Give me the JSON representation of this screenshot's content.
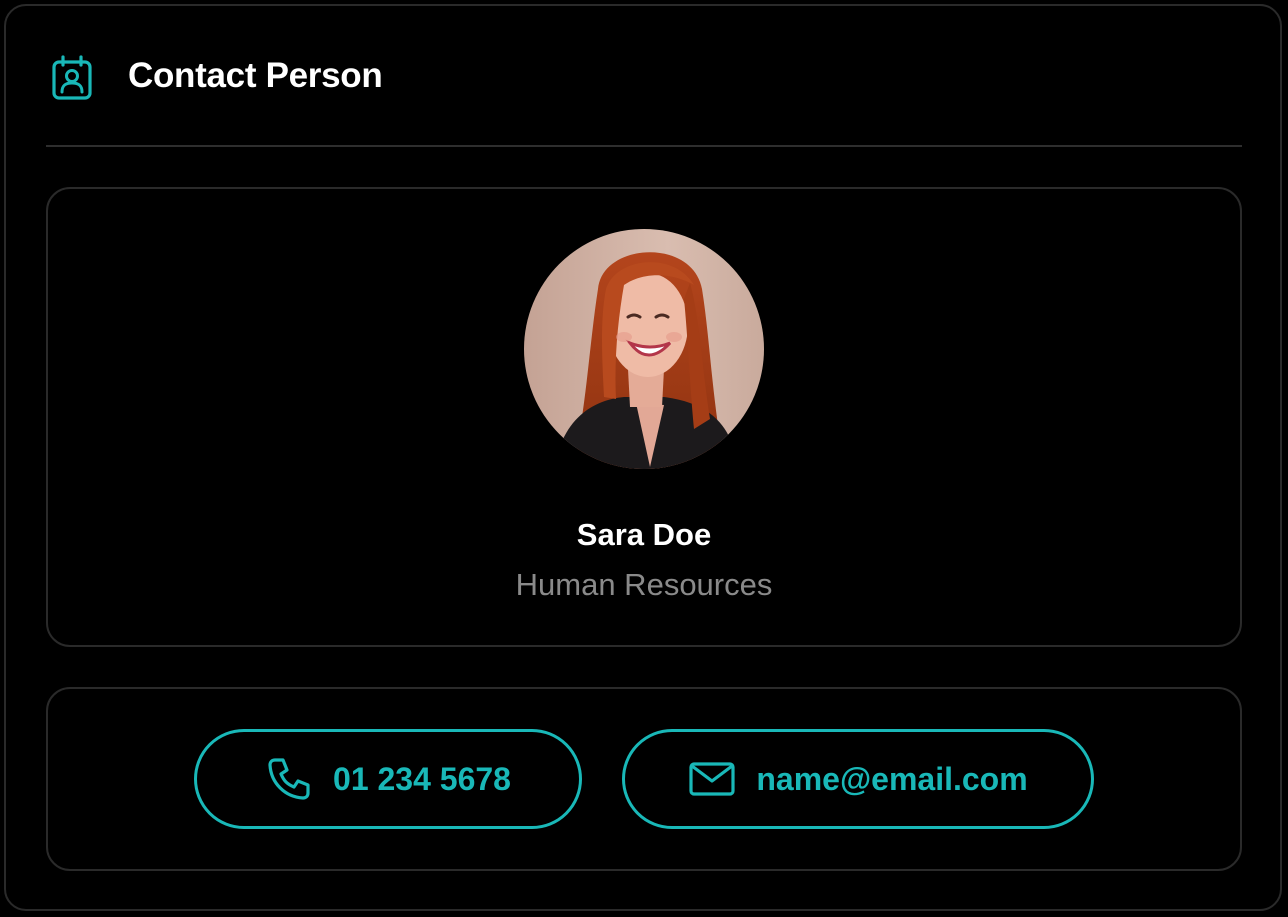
{
  "header": {
    "title": "Contact Person",
    "icon": "contact-book-icon"
  },
  "contact": {
    "name": "Sara Doe",
    "department": "Human Resources",
    "photo": "avatar-photo"
  },
  "actions": {
    "phone_label": "01 234 5678",
    "phone_icon": "phone-icon",
    "email_label": "name@email.com",
    "email_icon": "envelope-icon"
  },
  "colors": {
    "accent": "#19b8b8",
    "background": "#000000",
    "border": "#2a2a2a",
    "muted_text": "#8a8a8a"
  }
}
